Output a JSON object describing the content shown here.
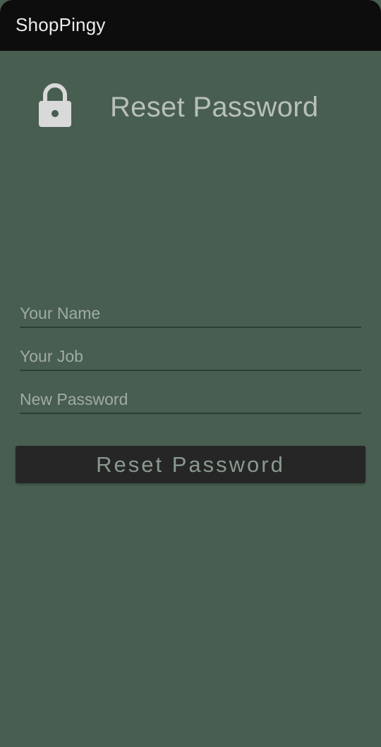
{
  "app_bar": {
    "title": "ShopPingy"
  },
  "header": {
    "icon": "lock-icon",
    "title": "Reset Password"
  },
  "form": {
    "name_placeholder": "Your Name",
    "name_value": "",
    "job_placeholder": "Your Job",
    "job_value": "",
    "password_placeholder": "New Password",
    "password_value": "",
    "submit_label": "Reset Password"
  },
  "colors": {
    "background": "#475e50",
    "app_bar": "#0d0d0d",
    "button": "#262626",
    "button_text": "#8a9990",
    "icon": "#d9d9d9"
  }
}
